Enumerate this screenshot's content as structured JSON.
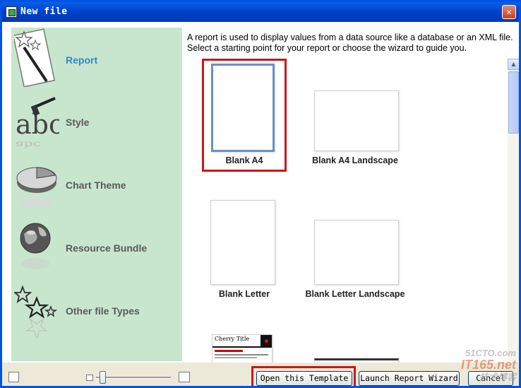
{
  "window": {
    "title": "New file",
    "close_glyph": "✕"
  },
  "sidebar": {
    "items": [
      {
        "label": "Report",
        "icon": "report-wand-icon",
        "active": true
      },
      {
        "label": "Style",
        "icon": "style-brush-icon",
        "active": false
      },
      {
        "label": "Chart Theme",
        "icon": "chart-pie-icon",
        "active": false
      },
      {
        "label": "Resource Bundle",
        "icon": "globe-icon",
        "active": false
      },
      {
        "label": "Other file Types",
        "icon": "stars-icon",
        "active": false
      }
    ]
  },
  "description": {
    "line1": "A report is used to display values from a data source like a database or an XML file.",
    "line2": "Select a starting point for your report or choose the wizard to guide you."
  },
  "templates": [
    {
      "name": "Blank A4",
      "selected": true
    },
    {
      "name": "Blank A4 Landscape",
      "selected": false
    },
    {
      "name": "Blank Letter",
      "selected": false
    },
    {
      "name": "Blank Letter Landscape",
      "selected": false
    },
    {
      "name": "Cherry Title",
      "selected": false
    },
    {
      "name": "",
      "selected": false
    }
  ],
  "zoom": {
    "level": 0.05
  },
  "buttons": {
    "open_template": "Open this Template",
    "launch_wizard": "Launch Report Wizard",
    "cancel": "Cancel"
  },
  "watermark": {
    "line1": "51CTO.com",
    "line2": "IT165.net",
    "line3": "技术博客"
  },
  "colors": {
    "accent": "#2a8bd1",
    "sidebar_bg": "#c8e6cd",
    "highlight": "#c8171e",
    "titlebar": "#0a5fe8"
  }
}
